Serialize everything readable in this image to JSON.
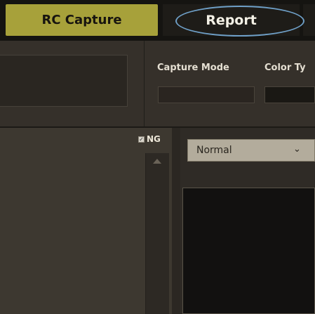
{
  "tabs": {
    "rc_capture": "RC Capture",
    "report": "Report"
  },
  "controls": {
    "capture_mode_label": "Capture Mode",
    "capture_mode_value": "",
    "color_type_label": "Color Ty",
    "color_type_value": ""
  },
  "list": {
    "ng_label": "NG",
    "ng_checked": true
  },
  "preview": {
    "mode_value": "Normal"
  },
  "icons": {
    "checkbox": "check-icon",
    "scroll_up": "scroll-up-icon",
    "dropdown": "chevron-down-icon"
  },
  "colors": {
    "active_tab": "#a7a13a",
    "highlight": "#6fa0c8"
  }
}
